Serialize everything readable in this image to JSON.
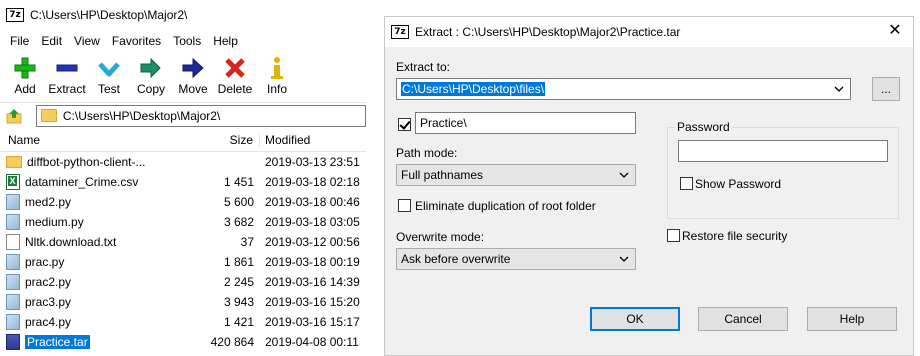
{
  "fm": {
    "title": "C:\\Users\\HP\\Desktop\\Major2\\",
    "menu": [
      "File",
      "Edit",
      "View",
      "Favorites",
      "Tools",
      "Help"
    ],
    "toolbar": [
      {
        "label": "Add",
        "icon": "plus-icon",
        "color": "#16b816"
      },
      {
        "label": "Extract",
        "icon": "minus-icon",
        "color": "#2433b4"
      },
      {
        "label": "Test",
        "icon": "check-icon",
        "color": "#29a7d8"
      },
      {
        "label": "Copy",
        "icon": "double-arrow-icon",
        "color": "#1d8f6b"
      },
      {
        "label": "Move",
        "icon": "arrow-right-icon",
        "color": "#1b2a96"
      },
      {
        "label": "Delete",
        "icon": "x-icon",
        "color": "#d8241b"
      },
      {
        "label": "Info",
        "icon": "info-icon",
        "color": "#e0b400"
      }
    ],
    "address": "C:\\Users\\HP\\Desktop\\Major2\\",
    "columns": {
      "name": "Name",
      "size": "Size",
      "modified": "Modified"
    },
    "files": [
      {
        "name": "diffbot-python-client-...",
        "size": "",
        "modified": "2019-03-13 23:51",
        "type": "folder"
      },
      {
        "name": "dataminer_Crime.csv",
        "size": "1 451",
        "modified": "2019-03-18 02:18",
        "type": "csv"
      },
      {
        "name": "med2.py",
        "size": "5 600",
        "modified": "2019-03-18 00:46",
        "type": "py"
      },
      {
        "name": "medium.py",
        "size": "3 682",
        "modified": "2019-03-18 03:05",
        "type": "py"
      },
      {
        "name": "Nltk.download.txt",
        "size": "37",
        "modified": "2019-03-12 00:56",
        "type": "txt"
      },
      {
        "name": "prac.py",
        "size": "1 861",
        "modified": "2019-03-18 00:19",
        "type": "py"
      },
      {
        "name": "prac2.py",
        "size": "2 245",
        "modified": "2019-03-16 14:39",
        "type": "py"
      },
      {
        "name": "prac3.py",
        "size": "3 943",
        "modified": "2019-03-16 15:20",
        "type": "py"
      },
      {
        "name": "prac4.py",
        "size": "1 421",
        "modified": "2019-03-16 15:17",
        "type": "py"
      },
      {
        "name": "Practice.tar",
        "size": "420 864",
        "modified": "2019-04-08 00:11",
        "type": "tar",
        "selected": true
      }
    ]
  },
  "dialog": {
    "title": "Extract : C:\\Users\\HP\\Desktop\\Major2\\Practice.tar",
    "close": "✕",
    "extract_to_label": "Extract to:",
    "extract_to_value": "C:\\Users\\HP\\Desktop\\files\\",
    "browse_label": "...",
    "subfolder_checked": true,
    "subfolder_value": "Practice\\",
    "path_mode_label": "Path mode:",
    "path_mode_value": "Full pathnames",
    "eliminate_dup_label": "Eliminate duplication of root folder",
    "eliminate_dup_checked": false,
    "overwrite_mode_label": "Overwrite mode:",
    "overwrite_mode_value": "Ask before overwrite",
    "password_label": "Password",
    "password_value": "",
    "show_password_label": "Show Password",
    "show_password_checked": false,
    "restore_security_label": "Restore file security",
    "restore_security_checked": false,
    "ok_label": "OK",
    "cancel_label": "Cancel",
    "help_label": "Help"
  }
}
